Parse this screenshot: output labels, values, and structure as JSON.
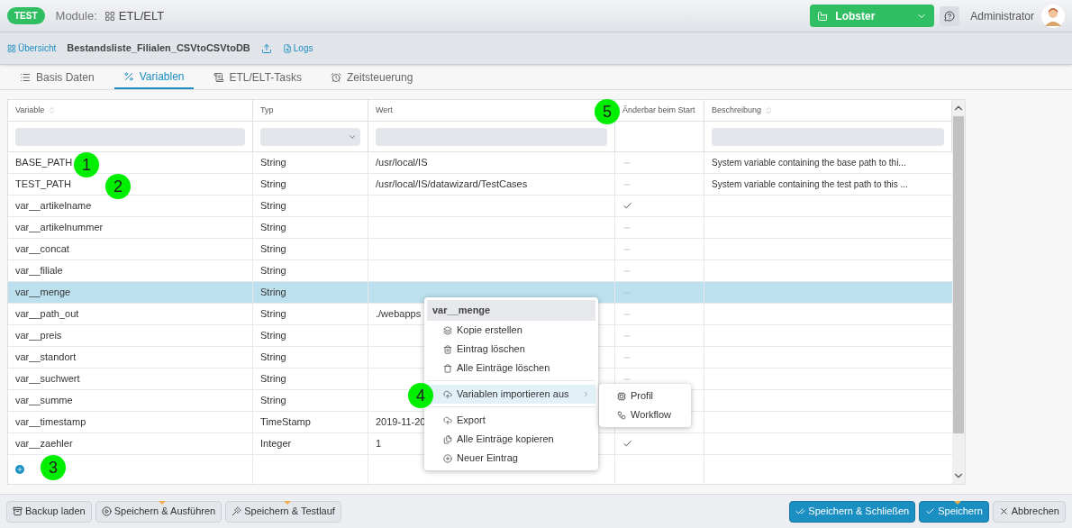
{
  "header": {
    "badge": "TEST",
    "module_label": "Module:",
    "module_name": "ETL/ELT",
    "tenant": "Lobster",
    "user": "Administrator"
  },
  "toolbar": {
    "overview": "Übersicht",
    "title": "Bestandsliste_Filialen_CSVtoCSVtoDB",
    "logs": "Logs"
  },
  "tabs": [
    {
      "label": "Basis Daten",
      "selected": false
    },
    {
      "label": "Variablen",
      "selected": true
    },
    {
      "label": "ETL/ELT-Tasks",
      "selected": false
    },
    {
      "label": "Zeitsteuerung",
      "selected": false
    }
  ],
  "table": {
    "columns": [
      {
        "label": "Variable",
        "sortable": true
      },
      {
        "label": "Typ",
        "sortable": false
      },
      {
        "label": "Wert",
        "sortable": false
      },
      {
        "label": "Änderbar beim Start",
        "sortable": false
      },
      {
        "label": "Beschreibung",
        "sortable": true
      }
    ],
    "rows": [
      {
        "variable": "BASE_PATH",
        "type": "String",
        "value": "/usr/local/IS",
        "changeable": false,
        "description": "System variable containing the base path to thi...",
        "selected": false
      },
      {
        "variable": "TEST_PATH",
        "type": "String",
        "value": "/usr/local/IS/datawizard/TestCases",
        "changeable": false,
        "description": "System variable containing the test path to this ...",
        "selected": false
      },
      {
        "variable": "var__artikelname",
        "type": "String",
        "changeable": true,
        "selected": false
      },
      {
        "variable": "var__artikelnummer",
        "type": "String",
        "changeable": false,
        "selected": false
      },
      {
        "variable": "var__concat",
        "type": "String",
        "changeable": false,
        "selected": false
      },
      {
        "variable": "var__filiale",
        "type": "String",
        "changeable": false,
        "selected": false
      },
      {
        "variable": "var__menge",
        "type": "String",
        "changeable": false,
        "selected": true
      },
      {
        "variable": "var__path_out",
        "type": "String",
        "value": "./webapps",
        "changeable": false,
        "selected": false
      },
      {
        "variable": "var__preis",
        "type": "String",
        "changeable": false,
        "selected": false
      },
      {
        "variable": "var__standort",
        "type": "String",
        "changeable": false,
        "selected": false
      },
      {
        "variable": "var__suchwert",
        "type": "String",
        "changeable": false,
        "selected": false
      },
      {
        "variable": "var__summe",
        "type": "String",
        "selected": false
      },
      {
        "variable": "var__timestamp",
        "type": "TimeStamp",
        "value": "2019-11-20",
        "selected": false
      },
      {
        "variable": "var__zaehler",
        "type": "Integer",
        "value": "1",
        "changeable": true,
        "selected": false
      }
    ]
  },
  "context_menu": {
    "title": "var__menge",
    "items": [
      {
        "kind": "item",
        "label": "Kopie erstellen",
        "selected": false
      },
      {
        "kind": "item",
        "label": "Eintrag löschen",
        "selected": false
      },
      {
        "kind": "item",
        "label": "Alle Einträge löschen",
        "selected": false
      },
      {
        "kind": "separator"
      },
      {
        "kind": "submenu",
        "label": "Variablen importieren aus",
        "selected": true
      },
      {
        "kind": "separator"
      },
      {
        "kind": "item",
        "label": "Export",
        "selected": false
      },
      {
        "kind": "item",
        "label": "Alle Einträge kopieren",
        "selected": false
      },
      {
        "kind": "item",
        "label": "Neuer Eintrag",
        "selected": false
      }
    ],
    "submenu": [
      {
        "label": "Profil"
      },
      {
        "label": "Workflow"
      }
    ]
  },
  "callouts": [
    "1",
    "2",
    "3",
    "4",
    "5"
  ],
  "footer": {
    "left": [
      {
        "label": "Backup laden",
        "marker": false
      },
      {
        "label": "Speichern & Ausführen",
        "marker": true
      },
      {
        "label": "Speichern & Testlauf",
        "marker": true
      }
    ],
    "right": [
      {
        "label": "Speichern & Schließen",
        "primary": true,
        "marker": false
      },
      {
        "label": "Speichern",
        "primary": true,
        "marker": true
      },
      {
        "label": "Abbrechen",
        "primary": false,
        "marker": false
      }
    ]
  }
}
